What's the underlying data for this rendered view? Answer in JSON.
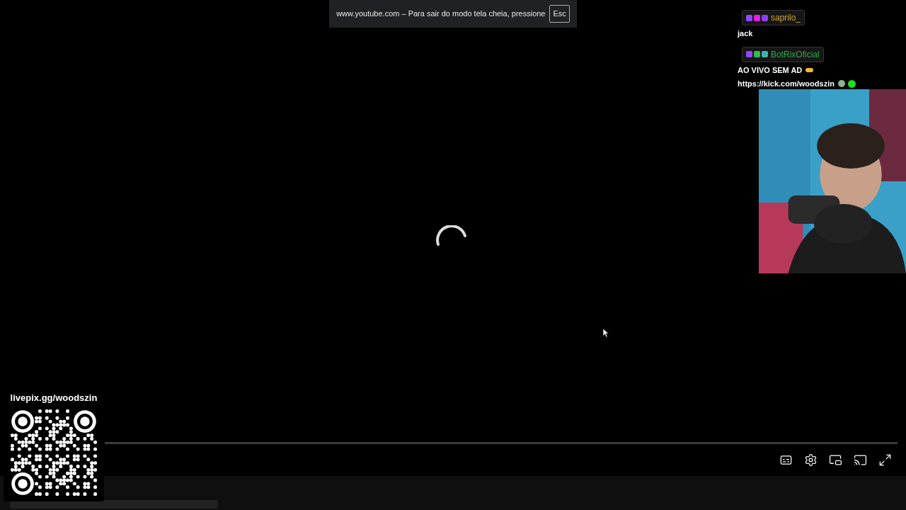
{
  "fullscreen_notice": {
    "text": "www.youtube.com – Para sair do modo tela cheia, pressione",
    "key": "Esc"
  },
  "chat": {
    "messages": [
      {
        "user": "saprilo_",
        "color": "#d4a62a",
        "lines": [
          "jack"
        ],
        "bot": false
      },
      {
        "user": "BotRixOficial",
        "color": "#2fa84f",
        "lines": [
          "AO VIVO SEM AD",
          "https://kick.com/woodszin"
        ],
        "bot": true
      }
    ]
  },
  "player": {
    "loading": true
  },
  "donation": {
    "label": "livepix.gg/woodszin"
  }
}
